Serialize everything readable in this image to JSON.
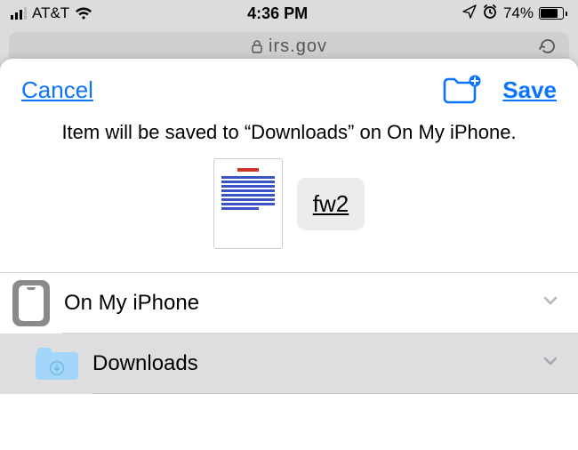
{
  "status": {
    "carrier": "AT&T",
    "time": "4:36 PM",
    "battery_pct": "74%"
  },
  "address": {
    "url_fragment": "irs.gov"
  },
  "sheet": {
    "cancel": "Cancel",
    "save": "Save",
    "message": "Item will be saved to “Downloads” on On My iPhone.",
    "filename": "fw2"
  },
  "locations": {
    "root": {
      "label": "On My iPhone"
    },
    "child": {
      "label": "Downloads"
    }
  },
  "icons": {
    "new_folder": "new-folder-icon",
    "phone": "iphone-icon",
    "downloads_folder": "downloads-folder-icon",
    "chevron": "chevron-down-icon",
    "location_arrow": "location-arrow-icon",
    "alarm": "alarm-icon",
    "wifi": "wifi-icon",
    "signal": "signal-icon",
    "reload": "reload-icon"
  }
}
